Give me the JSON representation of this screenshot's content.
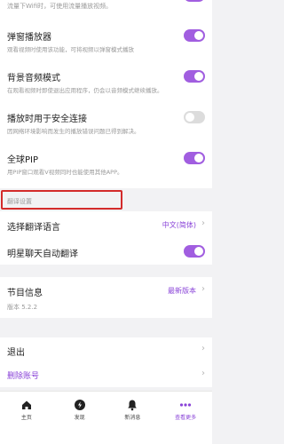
{
  "partial_setting": {
    "desc": "流量下Wifi时，可使用流量播放视频。",
    "enabled": true
  },
  "settings": [
    {
      "title": "弹窗播放器",
      "desc": "观看视频时使用该功能，可将视频以弹窗模式播放",
      "enabled": true
    },
    {
      "title": "背景音频模式",
      "desc": "在观看视频时即使退出应用程序，仍会以音频模式继续播放。",
      "enabled": true
    },
    {
      "title": "播放时用于安全连接",
      "desc": "因网络环境影响而发生的播放错误问题已得到解决。",
      "enabled": false
    },
    {
      "title": "全球PIP",
      "desc": "用PIP窗口观看V视频同时也能使用其他APP。",
      "enabled": true
    }
  ],
  "translation": {
    "section_header": "翻译设置",
    "language_label": "选择翻译语言",
    "language_value": "中文(简体)",
    "auto_label": "明星聊天自动翻译",
    "auto_enabled": true
  },
  "program_info": {
    "title": "节目信息",
    "latest": "最新版本",
    "version": "版本 5.2.2"
  },
  "account": {
    "exit": "退出",
    "delete": "删除账号"
  },
  "tabs": [
    {
      "label": "主页",
      "icon": "home-icon"
    },
    {
      "label": "发现",
      "icon": "discover-icon"
    },
    {
      "label": "新消息",
      "icon": "bell-icon"
    },
    {
      "label": "查看更多",
      "icon": "more-dots-icon",
      "active": true
    }
  ],
  "colors": {
    "accent": "#8a44d8",
    "toggle_on": "#a15ee0",
    "highlight": "#d32b2b"
  }
}
